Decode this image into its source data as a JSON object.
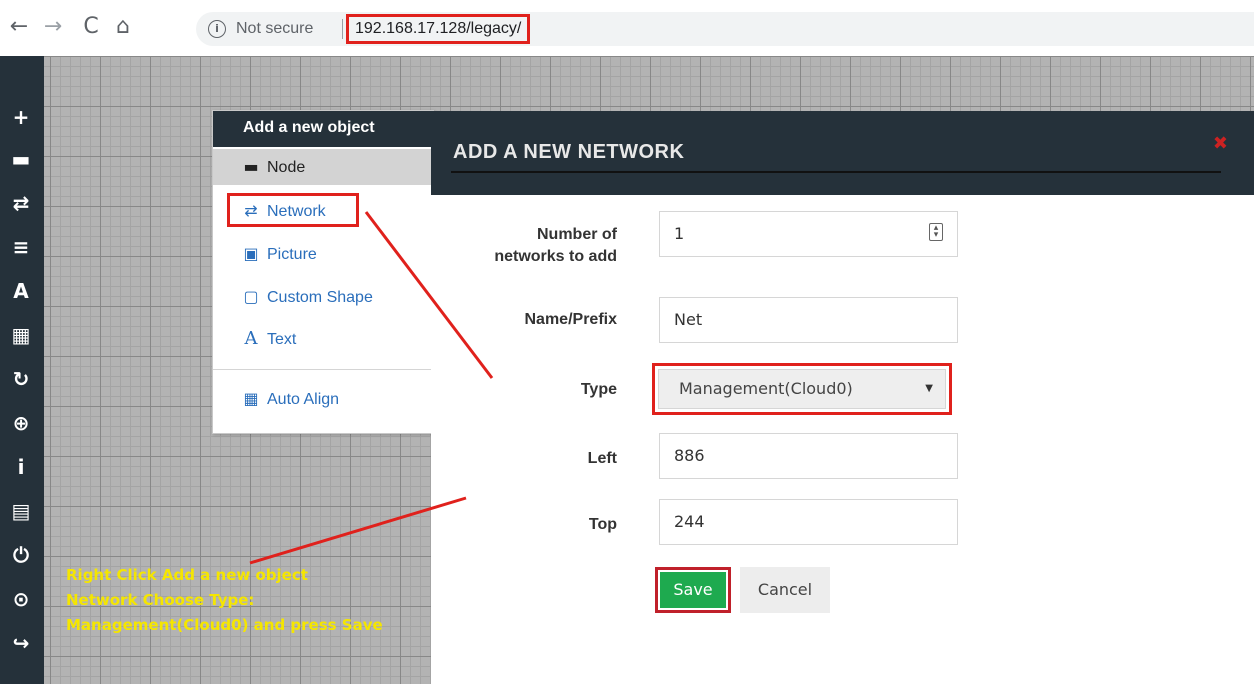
{
  "browser": {
    "back_icon": "←",
    "forward_icon": "→",
    "reload_icon": "C",
    "home_icon": "⌂",
    "info_icon": "i",
    "security_text": "Not secure",
    "url": "192.168.17.128/legacy/"
  },
  "sidebar": {
    "icons": [
      "add-icon",
      "node-icon",
      "network-icon",
      "list-icon",
      "text-icon",
      "grid-icon",
      "refresh-icon",
      "zoom-icon",
      "info-icon",
      "table-icon",
      "power-icon",
      "check-icon",
      "logout-icon"
    ],
    "glyphs": [
      "+",
      "▬",
      "⇄",
      "≡",
      "A",
      "▦",
      "↻",
      "⊕",
      "i",
      "▤",
      "⏻",
      "⊙",
      "↪"
    ]
  },
  "context_menu": {
    "title": "Add a new object",
    "items": [
      {
        "label": "Node",
        "icon": "▬"
      },
      {
        "label": "Network",
        "icon": "⇄"
      },
      {
        "label": "Picture",
        "icon": "▣"
      },
      {
        "label": "Custom Shape",
        "icon": "▢"
      },
      {
        "label": "Text",
        "icon": "A"
      },
      {
        "label": "Auto Align",
        "icon": "▦"
      }
    ]
  },
  "modal": {
    "title": "ADD A NEW NETWORK",
    "close_icon": "✖",
    "fields": {
      "count_label": "Number of networks to add",
      "count_value": "1",
      "name_label": "Name/Prefix",
      "name_value": "Net",
      "type_label": "Type",
      "type_value": "Management(Cloud0)",
      "left_label": "Left",
      "left_value": "886",
      "top_label": "Top",
      "top_value": "244"
    },
    "save_label": "Save",
    "cancel_label": "Cancel"
  },
  "annotation": {
    "line1": "Right Click Add a new object",
    "line2": "Network Choose Type:",
    "line3": "Management(Cloud0) and press Save",
    "text_color": "#f5e600",
    "highlight_color": "#e0211c"
  }
}
